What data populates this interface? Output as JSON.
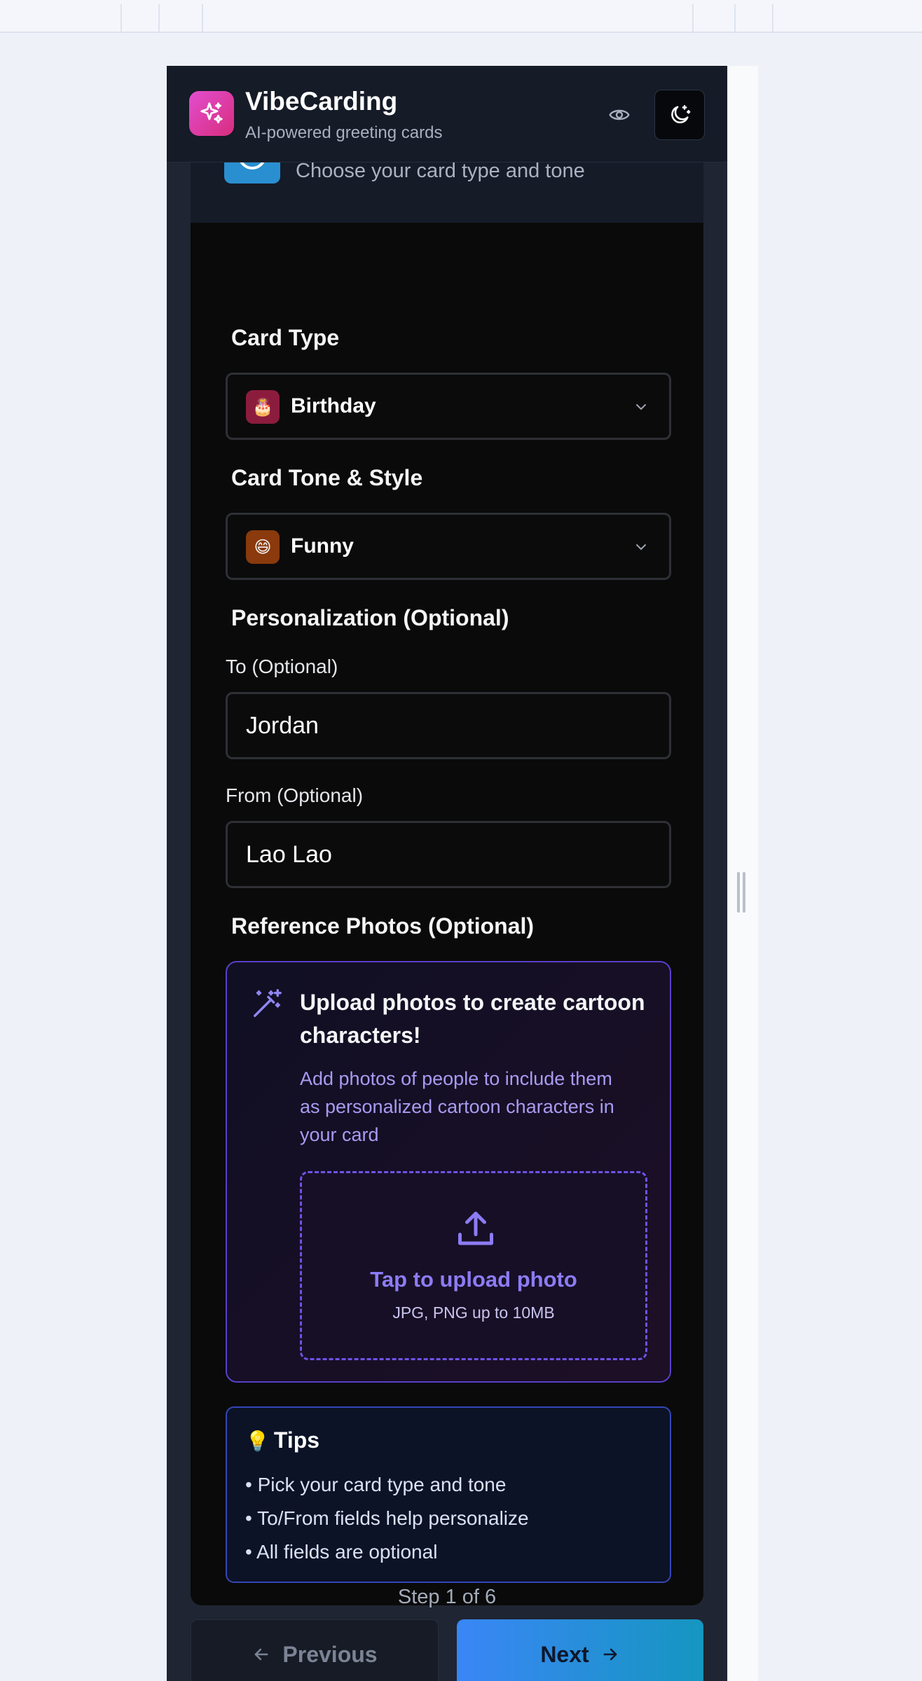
{
  "header": {
    "title": "VibeCarding",
    "subtitle": "AI-powered greeting cards"
  },
  "step": {
    "subtitle": "Choose your card type and tone",
    "counter": "Step 1 of 6"
  },
  "form": {
    "card_type_label": "Card Type",
    "card_type_value": "Birthday",
    "card_type_emoji": "🎂",
    "tone_label": "Card Tone & Style",
    "tone_value": "Funny",
    "tone_emoji": "😄",
    "personalization_label": "Personalization (Optional)",
    "to_label": "To (Optional)",
    "to_value": "Jordan",
    "from_label": "From (Optional)",
    "from_value": "Lao Lao",
    "photos_label": "Reference Photos (Optional)"
  },
  "upload": {
    "title": "Upload photos to create cartoon characters!",
    "description": "Add photos of people to include them as personalized cartoon characters in your card",
    "drop_main": "Tap to upload photo",
    "drop_sub": "JPG, PNG up to 10MB"
  },
  "tips": {
    "icon": "💡",
    "title": "Tips",
    "items": [
      "• Pick your card type and tone",
      "• To/From fields help personalize",
      "• All fields are optional"
    ]
  },
  "nav": {
    "previous_label": "Previous",
    "next_label": "Next"
  },
  "colors": {
    "accent_purple": "#6f52e8",
    "accent_blue": "#3a86f6",
    "logo_pink": "#e24ecf"
  },
  "icons": {
    "logo": "sparkles-icon",
    "preview": "eye-icon",
    "theme": "moon-stars-icon",
    "select": "chevron-down-icon",
    "upload_hint": "magic-wand-icon",
    "upload": "upload-icon",
    "previous": "arrow-left-icon",
    "next": "arrow-right-icon"
  }
}
